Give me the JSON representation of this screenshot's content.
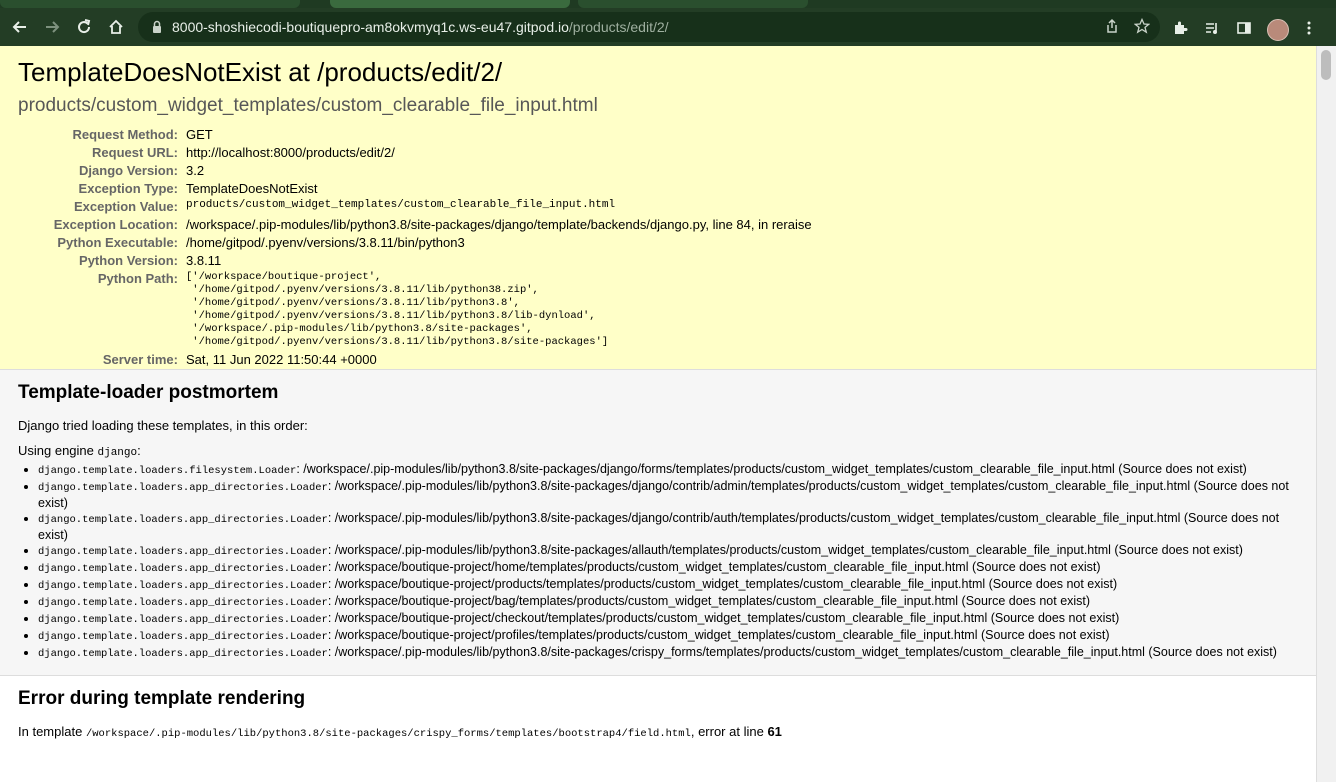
{
  "browser": {
    "url_host": "8000-shoshiecodi-boutiquepro-am8okvmyq1c.ws-eu47.gitpod.io",
    "url_path": "/products/edit/2/"
  },
  "summary": {
    "title": "TemplateDoesNotExist at /products/edit/2/",
    "subtitle": "products/custom_widget_templates/custom_clearable_file_input.html",
    "rows": [
      {
        "label": "Request Method:",
        "value": "GET"
      },
      {
        "label": "Request URL:",
        "value": "http://localhost:8000/products/edit/2/"
      },
      {
        "label": "Django Version:",
        "value": "3.2"
      },
      {
        "label": "Exception Type:",
        "value": "TemplateDoesNotExist"
      },
      {
        "label": "Exception Value:",
        "value": "products/custom_widget_templates/custom_clearable_file_input.html"
      },
      {
        "label": "Exception Location:",
        "value": "/workspace/.pip-modules/lib/python3.8/site-packages/django/template/backends/django.py, line 84, in reraise"
      },
      {
        "label": "Python Executable:",
        "value": "/home/gitpod/.pyenv/versions/3.8.11/bin/python3"
      },
      {
        "label": "Python Version:",
        "value": "3.8.11"
      },
      {
        "label": "Python Path:",
        "value": "['/workspace/boutique-project',\n '/home/gitpod/.pyenv/versions/3.8.11/lib/python38.zip',\n '/home/gitpod/.pyenv/versions/3.8.11/lib/python3.8',\n '/home/gitpod/.pyenv/versions/3.8.11/lib/python3.8/lib-dynload',\n '/workspace/.pip-modules/lib/python3.8/site-packages',\n '/home/gitpod/.pyenv/versions/3.8.11/lib/python3.8/site-packages']"
      },
      {
        "label": "Server time:",
        "value": "Sat, 11 Jun 2022 11:50:44 +0000"
      }
    ]
  },
  "postmortem": {
    "heading": "Template-loader postmortem",
    "intro": "Django tried loading these templates, in this order:",
    "engine_prefix": "Using engine ",
    "engine_name": "django",
    "engine_suffix": ":",
    "loaders": [
      {
        "loader": "django.template.loaders.filesystem.Loader",
        "path": ": /workspace/.pip-modules/lib/python3.8/site-packages/django/forms/templates/products/custom_widget_templates/custom_clearable_file_input.html (Source does not exist)"
      },
      {
        "loader": "django.template.loaders.app_directories.Loader",
        "path": ": /workspace/.pip-modules/lib/python3.8/site-packages/django/contrib/admin/templates/products/custom_widget_templates/custom_clearable_file_input.html (Source does not exist)"
      },
      {
        "loader": "django.template.loaders.app_directories.Loader",
        "path": ": /workspace/.pip-modules/lib/python3.8/site-packages/django/contrib/auth/templates/products/custom_widget_templates/custom_clearable_file_input.html (Source does not exist)"
      },
      {
        "loader": "django.template.loaders.app_directories.Loader",
        "path": ": /workspace/.pip-modules/lib/python3.8/site-packages/allauth/templates/products/custom_widget_templates/custom_clearable_file_input.html (Source does not exist)"
      },
      {
        "loader": "django.template.loaders.app_directories.Loader",
        "path": ": /workspace/boutique-project/home/templates/products/custom_widget_templates/custom_clearable_file_input.html (Source does not exist)"
      },
      {
        "loader": "django.template.loaders.app_directories.Loader",
        "path": ": /workspace/boutique-project/products/templates/products/custom_widget_templates/custom_clearable_file_input.html (Source does not exist)"
      },
      {
        "loader": "django.template.loaders.app_directories.Loader",
        "path": ": /workspace/boutique-project/bag/templates/products/custom_widget_templates/custom_clearable_file_input.html (Source does not exist)"
      },
      {
        "loader": "django.template.loaders.app_directories.Loader",
        "path": ": /workspace/boutique-project/checkout/templates/products/custom_widget_templates/custom_clearable_file_input.html (Source does not exist)"
      },
      {
        "loader": "django.template.loaders.app_directories.Loader",
        "path": ": /workspace/boutique-project/profiles/templates/products/custom_widget_templates/custom_clearable_file_input.html (Source does not exist)"
      },
      {
        "loader": "django.template.loaders.app_directories.Loader",
        "path": ": /workspace/.pip-modules/lib/python3.8/site-packages/crispy_forms/templates/products/custom_widget_templates/custom_clearable_file_input.html (Source does not exist)"
      }
    ]
  },
  "rendering": {
    "heading": "Error during template rendering",
    "prefix": "In template ",
    "template_path": "/workspace/.pip-modules/lib/python3.8/site-packages/crispy_forms/templates/bootstrap4/field.html",
    "middle": ", error at line ",
    "line": "61"
  }
}
